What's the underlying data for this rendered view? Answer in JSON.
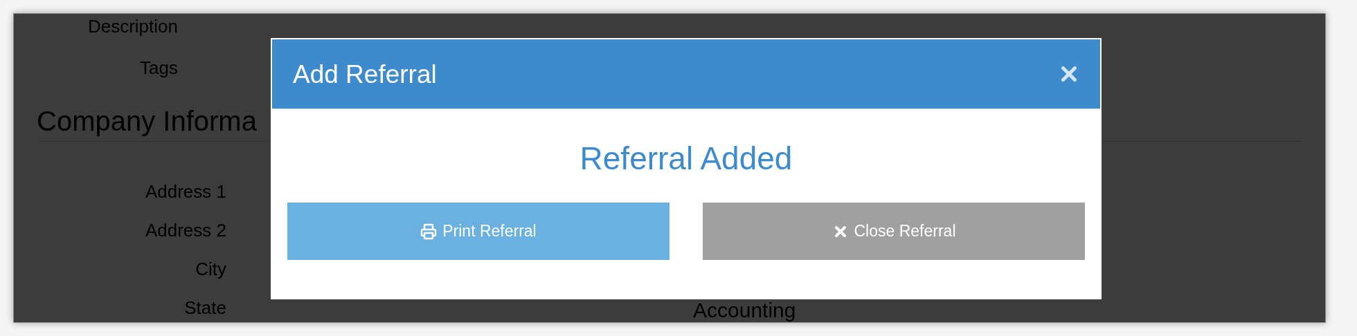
{
  "form": {
    "top_labels": [
      "Description",
      "Tags"
    ],
    "section_heading": "Company Informa",
    "address_labels": [
      "Address 1",
      "Address 2",
      "City",
      "State"
    ],
    "second_heading": "Accounting"
  },
  "modal": {
    "title": "Add Referral",
    "message": "Referral Added",
    "buttons": [
      {
        "label": "Print Referral",
        "kind": "print"
      },
      {
        "label": "Close Referral",
        "kind": "close"
      }
    ]
  }
}
